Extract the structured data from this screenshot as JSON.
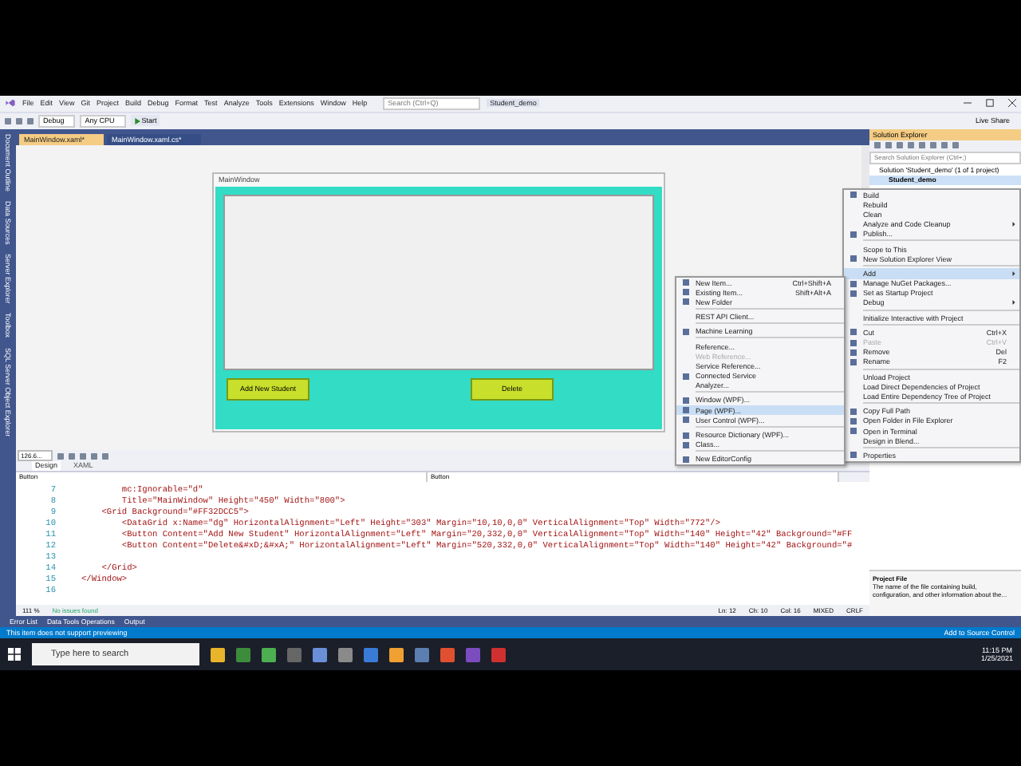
{
  "menu_bar": {
    "items": [
      "File",
      "Edit",
      "View",
      "Git",
      "Project",
      "Build",
      "Debug",
      "Format",
      "Test",
      "Analyze",
      "Tools",
      "Extensions",
      "Window",
      "Help"
    ],
    "search": {
      "placeholder": "Search (Ctrl+Q)"
    },
    "solution_name": "Student_demo"
  },
  "toolbar": {
    "configuration": "Debug",
    "platform": "Any CPU",
    "start": "Start",
    "live_share": "Live Share"
  },
  "side_tabs": [
    "Document Outline",
    "Data Sources",
    "Server Explorer",
    "Toolbox",
    "SQL Server Object Explorer"
  ],
  "document_tabs": [
    {
      "label": "MainWindow.xaml*",
      "selected": true
    },
    {
      "label": "MainWindow.xaml.cs*",
      "selected": false
    }
  ],
  "designer": {
    "window_title": "MainWindow",
    "buttons": [
      "Add New Student",
      "Delete"
    ],
    "zoom": "126.6..."
  },
  "view_tabs": [
    {
      "label": "Design",
      "selected": true
    },
    {
      "label": "XAML",
      "selected": false
    }
  ],
  "breadcrumbs": [
    "Button",
    "Button"
  ],
  "code_lines": [
    {
      "number": "7",
      "code": "        mc:Ignorable=\"d\""
    },
    {
      "number": "8",
      "code": "        Title=\"MainWindow\" Height=\"450\" Width=\"800\">"
    },
    {
      "number": "9",
      "code": "    <Grid Background=\"#FF32DCC5\">"
    },
    {
      "number": "10",
      "code": "        <DataGrid x:Name=\"dg\" HorizontalAlignment=\"Left\" Height=\"303\" Margin=\"10,10,0,0\" VerticalAlignment=\"Top\" Width=\"772\"/>"
    },
    {
      "number": "11",
      "code": "        <Button Content=\"Add New Student\" HorizontalAlignment=\"Left\" Margin=\"20,332,0,0\" VerticalAlignment=\"Top\" Width=\"140\" Height=\"42\" Background=\"#FF"
    },
    {
      "number": "12",
      "code": "        <Button Content=\"Delete&#xD;&#xA;\" HorizontalAlignment=\"Left\" Margin=\"520,332,0,0\" VerticalAlignment=\"Top\" Width=\"140\" Height=\"42\" Background=\"#"
    },
    {
      "number": "13"
    },
    {
      "number": "14",
      "code": "    </Grid>"
    },
    {
      "number": "15",
      "code": "</Window>"
    },
    {
      "number": "16"
    }
  ],
  "editor_status": {
    "zoom": "111 %",
    "issues": "No issues found",
    "line": "Ln: 12",
    "char": "Ch: 10",
    "col": "Col: 16",
    "whitespace": "MIXED",
    "line_ending": "CRLF"
  },
  "tool_tabs": [
    "Error List",
    "Data Tools Operations",
    "Output"
  ],
  "status_bar": {
    "message": "This item does not support previewing",
    "source_control": "Add to Source Control"
  },
  "solution_explorer": {
    "title": "Solution Explorer",
    "search": {
      "placeholder": "Search Solution Explorer (Ctrl+;)"
    },
    "tree": [
      {
        "label": "Solution 'Student_demo' (1 of 1 project)",
        "selected": false,
        "children": [
          {
            "label": "Student_demo",
            "selected": true
          }
        ]
      }
    ],
    "properties": {
      "title": "Project File",
      "description": "The name of the file containing build, configuration, and other information about the..."
    }
  },
  "context_menu": [
    {
      "kind": "item",
      "label": "Build",
      "icon": true,
      "selected": false,
      "disabled": false
    },
    {
      "kind": "item",
      "label": "Rebuild",
      "icon": false,
      "selected": false,
      "disabled": false
    },
    {
      "kind": "item",
      "label": "Clean",
      "icon": false,
      "selected": false,
      "disabled": false
    },
    {
      "kind": "item",
      "label": "Analyze and Code Cleanup",
      "icon": false,
      "submenu": true,
      "selected": false,
      "disabled": false
    },
    {
      "kind": "item",
      "label": "Publish...",
      "icon": true,
      "selected": false,
      "disabled": false
    },
    {
      "kind": "separator"
    },
    {
      "kind": "item",
      "label": "Scope to This",
      "icon": false,
      "selected": false,
      "disabled": false
    },
    {
      "kind": "item",
      "label": "New Solution Explorer View",
      "icon": true,
      "selected": false,
      "disabled": false
    },
    {
      "kind": "separator"
    },
    {
      "kind": "item",
      "label": "Add",
      "icon": false,
      "submenu": true,
      "selected": true,
      "disabled": false
    },
    {
      "kind": "item",
      "label": "Manage NuGet Packages...",
      "icon": true,
      "selected": false,
      "disabled": false
    },
    {
      "kind": "item",
      "label": "Set as Startup Project",
      "icon": true,
      "selected": false,
      "disabled": false
    },
    {
      "kind": "item",
      "label": "Debug",
      "icon": false,
      "submenu": true,
      "selected": false,
      "disabled": false
    },
    {
      "kind": "separator"
    },
    {
      "kind": "item",
      "label": "Initialize Interactive with Project",
      "icon": false,
      "selected": false,
      "disabled": false
    },
    {
      "kind": "separator"
    },
    {
      "kind": "item",
      "label": "Cut",
      "shortcut": "Ctrl+X",
      "icon": true,
      "selected": false,
      "disabled": false
    },
    {
      "kind": "item",
      "label": "Paste",
      "shortcut": "Ctrl+V",
      "icon": true,
      "selected": false,
      "disabled": true
    },
    {
      "kind": "item",
      "label": "Remove",
      "shortcut": "Del",
      "icon": true,
      "selected": false,
      "disabled": false
    },
    {
      "kind": "item",
      "label": "Rename",
      "shortcut": "F2",
      "icon": true,
      "selected": false,
      "disabled": false
    },
    {
      "kind": "separator"
    },
    {
      "kind": "item",
      "label": "Unload Project",
      "icon": false,
      "selected": false,
      "disabled": false
    },
    {
      "kind": "item",
      "label": "Load Direct Dependencies of Project",
      "icon": false,
      "selected": false,
      "disabled": false
    },
    {
      "kind": "item",
      "label": "Load Entire Dependency Tree of Project",
      "icon": false,
      "selected": false,
      "disabled": false
    },
    {
      "kind": "separator"
    },
    {
      "kind": "item",
      "label": "Copy Full Path",
      "icon": true,
      "selected": false,
      "disabled": false
    },
    {
      "kind": "item",
      "label": "Open Folder in File Explorer",
      "icon": true,
      "selected": false,
      "disabled": false
    },
    {
      "kind": "item",
      "label": "Open in Terminal",
      "icon": true,
      "selected": false,
      "disabled": false
    },
    {
      "kind": "item",
      "label": "Design in Blend...",
      "icon": false,
      "selected": false,
      "disabled": false
    },
    {
      "kind": "separator"
    },
    {
      "kind": "item",
      "label": "Properties",
      "icon": true,
      "selected": false,
      "disabled": false
    }
  ],
  "add_submenu": [
    {
      "kind": "item",
      "label": "New Item...",
      "shortcut": "Ctrl+Shift+A",
      "icon": true,
      "selected": false,
      "disabled": false
    },
    {
      "kind": "item",
      "label": "Existing Item...",
      "shortcut": "Shift+Alt+A",
      "icon": true,
      "selected": false,
      "disabled": false
    },
    {
      "kind": "item",
      "label": "New Folder",
      "icon": true,
      "selected": false,
      "disabled": false
    },
    {
      "kind": "separator"
    },
    {
      "kind": "item",
      "label": "REST API Client...",
      "icon": false,
      "selected": false,
      "disabled": false
    },
    {
      "kind": "separator"
    },
    {
      "kind": "item",
      "label": "Machine Learning",
      "icon": true,
      "selected": false,
      "disabled": false
    },
    {
      "kind": "separator"
    },
    {
      "kind": "item",
      "label": "Reference...",
      "icon": false,
      "selected": false,
      "disabled": false
    },
    {
      "kind": "item",
      "label": "Web Reference...",
      "icon": false,
      "selected": false,
      "disabled": true
    },
    {
      "kind": "item",
      "label": "Service Reference...",
      "icon": false,
      "selected": false,
      "disabled": false
    },
    {
      "kind": "item",
      "label": "Connected Service",
      "icon": true,
      "selected": false,
      "disabled": false
    },
    {
      "kind": "item",
      "label": "Analyzer...",
      "icon": false,
      "selected": false,
      "disabled": false
    },
    {
      "kind": "separator"
    },
    {
      "kind": "item",
      "label": "Window (WPF)...",
      "icon": true,
      "selected": false,
      "disabled": false
    },
    {
      "kind": "item",
      "label": "Page (WPF)...",
      "icon": true,
      "selected": true,
      "disabled": false
    },
    {
      "kind": "item",
      "label": "User Control (WPF)...",
      "icon": true,
      "selected": false,
      "disabled": false
    },
    {
      "kind": "separator"
    },
    {
      "kind": "item",
      "label": "Resource Dictionary (WPF)...",
      "icon": true,
      "selected": false,
      "disabled": false
    },
    {
      "kind": "item",
      "label": "Class...",
      "icon": true,
      "selected": false,
      "disabled": false
    },
    {
      "kind": "separator"
    },
    {
      "kind": "item",
      "label": "New EditorConfig",
      "icon": true,
      "selected": false,
      "disabled": false
    }
  ],
  "taskbar": {
    "search": {
      "placeholder": "Type here to search"
    },
    "time": "11:15 PM",
    "date": "1/25/2021"
  }
}
